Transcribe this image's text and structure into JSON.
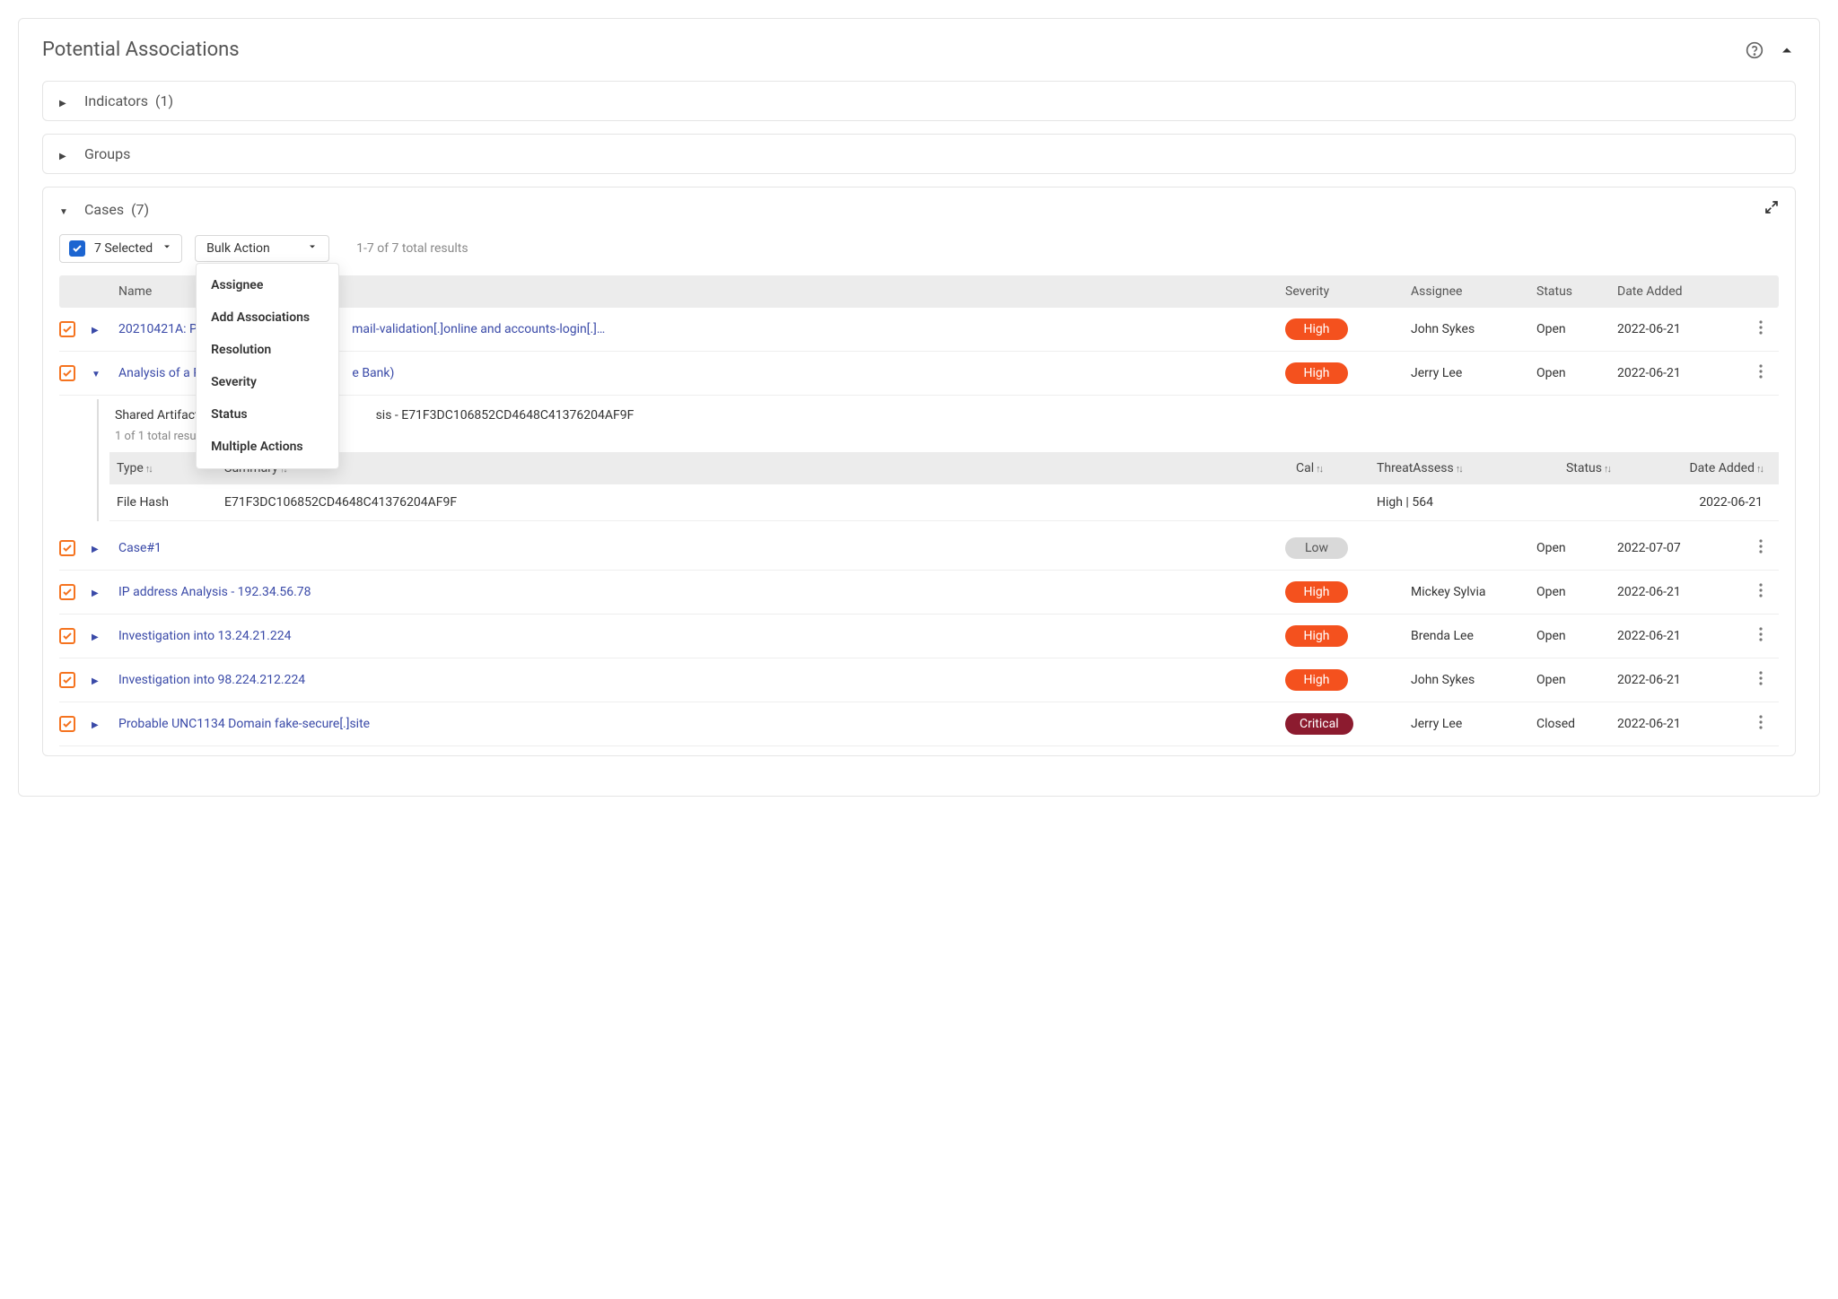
{
  "panel": {
    "title": "Potential Associations"
  },
  "sections": {
    "indicators": {
      "label": "Indicators",
      "count": "(1)"
    },
    "groups": {
      "label": "Groups"
    },
    "cases": {
      "label": "Cases",
      "count": "(7)"
    }
  },
  "toolbar": {
    "selected_label": "7 Selected",
    "bulk_action_label": "Bulk Action",
    "results_text": "1-7 of 7 total results"
  },
  "bulk_menu": [
    "Assignee",
    "Add Associations",
    "Resolution",
    "Severity",
    "Status",
    "Multiple Actions"
  ],
  "headers": {
    "name": "Name",
    "severity": "Severity",
    "assignee": "Assignee",
    "status": "Status",
    "date": "Date Added"
  },
  "rows": [
    {
      "name": "20210421A: Poss",
      "name_suffix": "mail-validation[.]online and accounts-login[.]…",
      "partial": true,
      "severity": "High",
      "sev_class": "sev-high",
      "assignee": "John Sykes",
      "status": "Open",
      "date": "2022-06-21",
      "expanded": false
    },
    {
      "name": "Analysis of a Phis",
      "name_suffix": "e Bank)",
      "partial": true,
      "severity": "High",
      "sev_class": "sev-high",
      "assignee": "Jerry Lee",
      "status": "Open",
      "date": "2022-06-21",
      "expanded": true
    },
    {
      "name": "Case#1",
      "severity": "Low",
      "sev_class": "sev-low",
      "assignee": "",
      "status": "Open",
      "date": "2022-07-07",
      "expanded": false
    },
    {
      "name": "IP address Analysis - 192.34.56.78",
      "severity": "High",
      "sev_class": "sev-high",
      "assignee": "Mickey Sylvia",
      "status": "Open",
      "date": "2022-06-21",
      "expanded": false
    },
    {
      "name": "Investigation into 13.24.21.224",
      "severity": "High",
      "sev_class": "sev-high",
      "assignee": "Brenda Lee",
      "status": "Open",
      "date": "2022-06-21",
      "expanded": false
    },
    {
      "name": "Investigation into 98.224.212.224",
      "severity": "High",
      "sev_class": "sev-high",
      "assignee": "John Sykes",
      "status": "Open",
      "date": "2022-06-21",
      "expanded": false
    },
    {
      "name": "Probable UNC1134 Domain fake-secure[.]site",
      "severity": "Critical",
      "sev_class": "sev-critical",
      "assignee": "Jerry Lee",
      "status": "Closed",
      "date": "2022-06-21",
      "expanded": false
    }
  ],
  "nested": {
    "title_prefix": "Shared Artifacts with",
    "title_suffix": "sis - E71F3DC106852CD4648C41376204AF9F",
    "subtext": "1 of 1 total result",
    "headers": {
      "type": "Type",
      "summary": "Summary",
      "cal": "Cal",
      "ta": "ThreatAssess",
      "status": "Status",
      "date": "Date Added"
    },
    "row": {
      "type": "File Hash",
      "summary": "E71F3DC106852CD4648C41376204AF9F",
      "cal": "",
      "ta": "High | 564",
      "status": "",
      "date": "2022-06-21"
    }
  }
}
